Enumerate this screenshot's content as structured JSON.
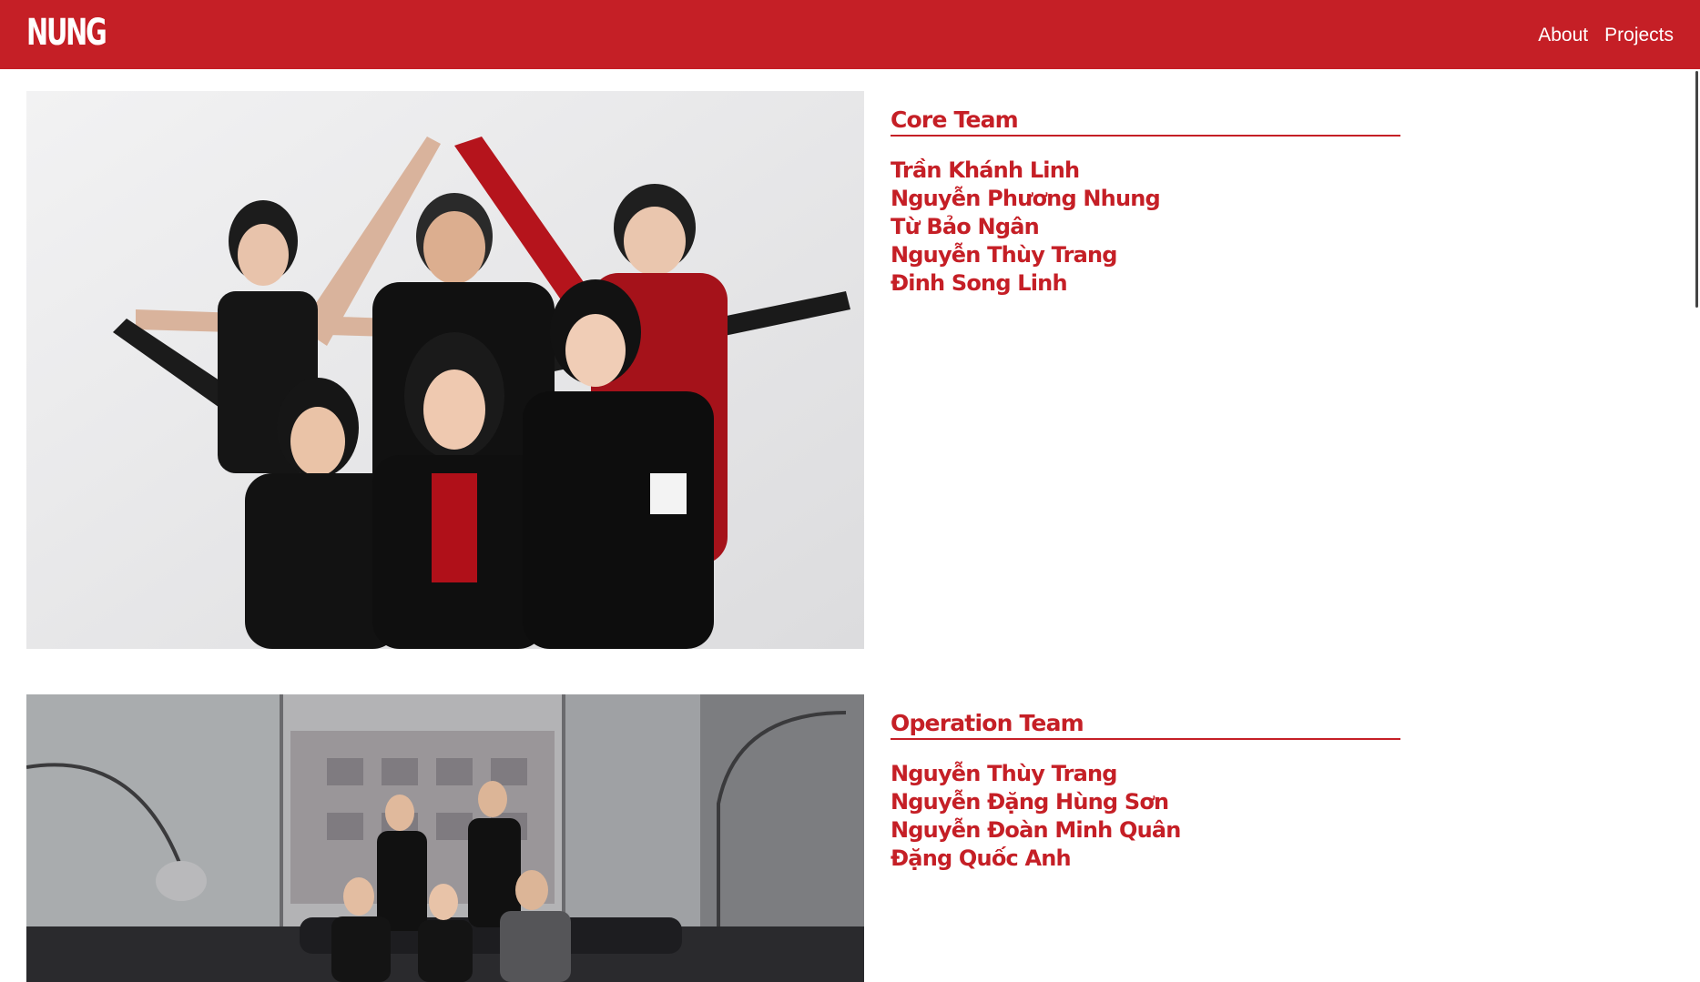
{
  "header": {
    "logo": "NUNG",
    "nav": [
      "About",
      "Projects"
    ],
    "bg_color": "#c51f26"
  },
  "teams": [
    {
      "title": "Core Team",
      "members": [
        "Trần Khánh Linh",
        "Nguyễn Phương Nhung",
        "Từ Bảo Ngân",
        "Nguyễn Thùy Trang",
        "Đinh Song Linh"
      ],
      "photo_icon": "group-photo"
    },
    {
      "title": "Operation Team",
      "members": [
        "Nguyễn Thùy Trang",
        "Nguyễn Đặng Hùng Sơn",
        "Nguyễn Đoàn Minh Quân",
        "Đặng Quốc Anh"
      ],
      "photo_icon": "group-photo"
    }
  ],
  "colors": {
    "accent": "#c51f26",
    "text_on_accent": "#ffffff"
  }
}
